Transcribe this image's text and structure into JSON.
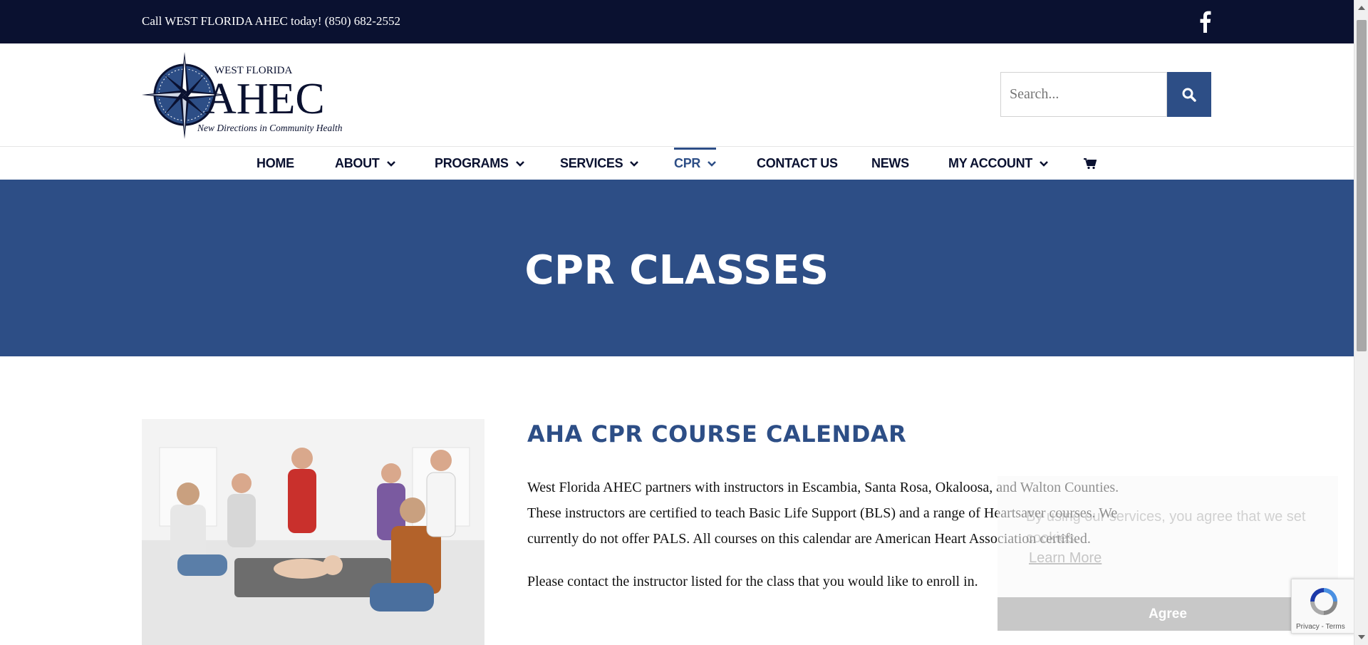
{
  "topbar": {
    "phone_text": "Call WEST FLORIDA AHEC today! (850) 682-2552",
    "social_icon": "facebook-icon"
  },
  "logo": {
    "line1": "WEST FLORIDA",
    "line2": "AHEC",
    "tagline": "New Directions in Community Health"
  },
  "search": {
    "placeholder": "Search...",
    "icon": "search-icon"
  },
  "nav": {
    "items": [
      {
        "label": "HOME"
      },
      {
        "label": "ABOUT"
      },
      {
        "label": "PROGRAMS"
      },
      {
        "label": "SERVICES"
      },
      {
        "label": "CPR"
      },
      {
        "label": "CONTACT US"
      },
      {
        "label": "NEWS"
      },
      {
        "label": "MY ACCOUNT"
      }
    ],
    "cart_icon": "cart-icon"
  },
  "banner": {
    "title": "CPR CLASSES"
  },
  "content": {
    "heading": "AHA CPR COURSE CALENDAR",
    "paragraph1_line1": "West Florida AHEC partners with instructors in Escambia, Santa Rosa, Okaloosa, and Walton Counties.",
    "paragraph1_line2": "These instructors are certified to teach Basic Life Support (BLS) and a range of Heartsaver courses. We",
    "paragraph1_line3": "currently do not offer PALS. All courses on this calendar are American Heart Association certified.",
    "paragraph2": "Please contact the instructor listed for the class that you would like to enroll in."
  },
  "cookie": {
    "text": "By using our services, you agree that we set cookies.",
    "learn_more": "Learn More",
    "agree": "Agree"
  },
  "recaptcha": {
    "terms": "Privacy - Terms"
  },
  "colors": {
    "topbar": "#0a1130",
    "brand_blue": "#2d4e86"
  }
}
